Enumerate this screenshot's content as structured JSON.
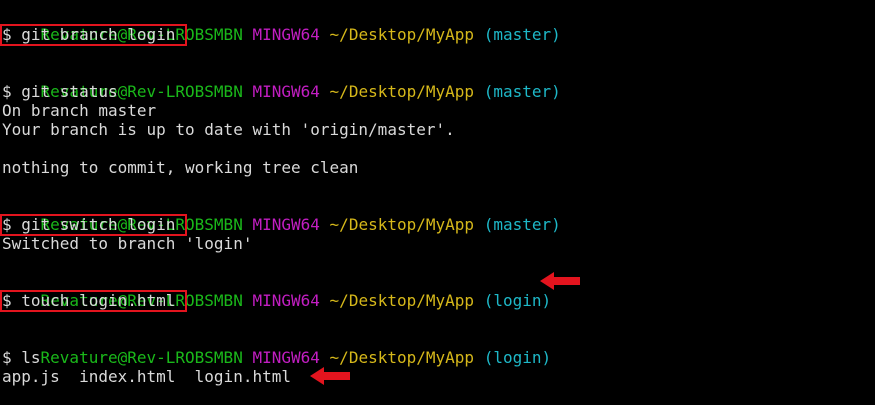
{
  "terminal": {
    "prompt_user": "Revature@Rev-LROBSMBN",
    "prompt_system": "MINGW64",
    "prompt_path": "~/Desktop/MyApp",
    "branch_master": "(master)",
    "branch_login": "(login)",
    "cmd_branch": "$ git branch login",
    "cmd_status": "$ git status",
    "out_status_1": "On branch master",
    "out_status_2": "Your branch is up to date with 'origin/master'.",
    "out_status_3": "nothing to commit, working tree clean",
    "cmd_switch": "$ git switch login",
    "out_switch": "Switched to branch 'login'",
    "cmd_touch": "$ touch login.html",
    "cmd_ls": "$ ls",
    "out_ls": "app.js  index.html  login.html"
  },
  "colors": {
    "background": "#000000",
    "user_host": "#1ab81a",
    "system": "#c21ec2",
    "path": "#d6b81a",
    "branch": "#1eb8c8",
    "text": "#d9d9d9",
    "annotation": "#e3141e"
  },
  "annotations": {
    "highlight_box_icon": "red-rectangle",
    "arrow_icon": "red-left-arrow"
  }
}
